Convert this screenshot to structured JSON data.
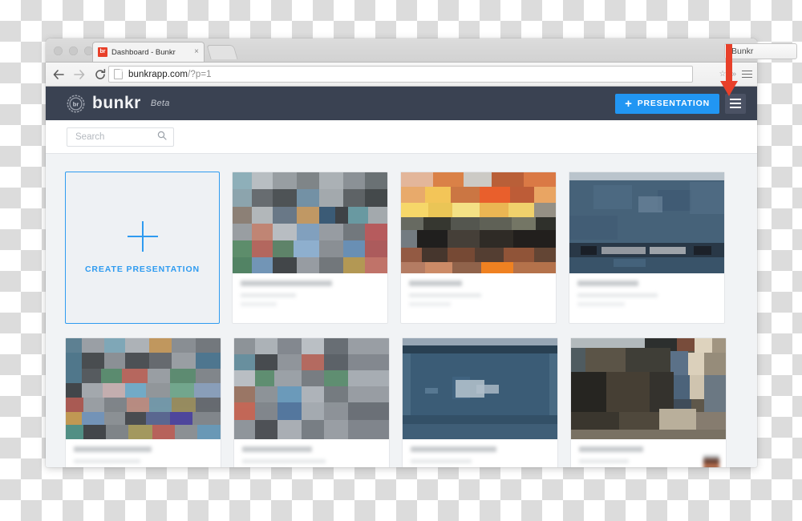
{
  "browser": {
    "traffic_lights": [
      "close",
      "minimize",
      "zoom"
    ],
    "tab": {
      "title": "Dashboard - Bunkr",
      "favicon_text": "br",
      "close_label": "×"
    },
    "toolbar": {
      "back_icon": "back-arrow-icon",
      "forward_icon": "forward-arrow-icon",
      "reload_icon": "reload-icon",
      "url_host": "bunkrapp.com",
      "url_path": "/?p=1",
      "bookmark_icon": "star-icon",
      "overflow_icon": "chevron-right-icon",
      "menu_icon": "hamburger-menu-icon"
    },
    "extension_button": "Bunkr"
  },
  "annotation": {
    "arrow": "red-down-arrow",
    "color": "#e8402a"
  },
  "app": {
    "brand": {
      "name": "bunkr",
      "beta": "Beta",
      "badge_text": "br"
    },
    "header": {
      "new_presentation_label": "PRESENTATION",
      "new_presentation_plus": "+",
      "menu_button": "hamburger-menu-button",
      "accent_color": "#2196f3",
      "bar_color": "#3a4252"
    },
    "search": {
      "placeholder": "Search",
      "value": "",
      "icon": "search-icon"
    },
    "create_card": {
      "label": "CREATE PRESENTATION",
      "icon": "plus-icon",
      "color": "#2e9bf0"
    },
    "cards": [
      {
        "name": "presentation-card-1",
        "thumb": "mosaic-multicolor",
        "has_avatar": false
      },
      {
        "name": "presentation-card-2",
        "thumb": "sunset-orange",
        "has_avatar": false
      },
      {
        "name": "presentation-card-3",
        "thumb": "navy-blue-photo",
        "has_avatar": false
      },
      {
        "name": "presentation-card-4",
        "thumb": "mosaic-multicolor-2",
        "has_avatar": false
      },
      {
        "name": "presentation-card-5",
        "thumb": "mosaic-multicolor-3",
        "has_avatar": false
      },
      {
        "name": "presentation-card-6",
        "thumb": "navy-blue-title-slide",
        "has_avatar": false
      },
      {
        "name": "presentation-card-7",
        "thumb": "dark-brown-interior",
        "has_avatar": true
      }
    ]
  }
}
